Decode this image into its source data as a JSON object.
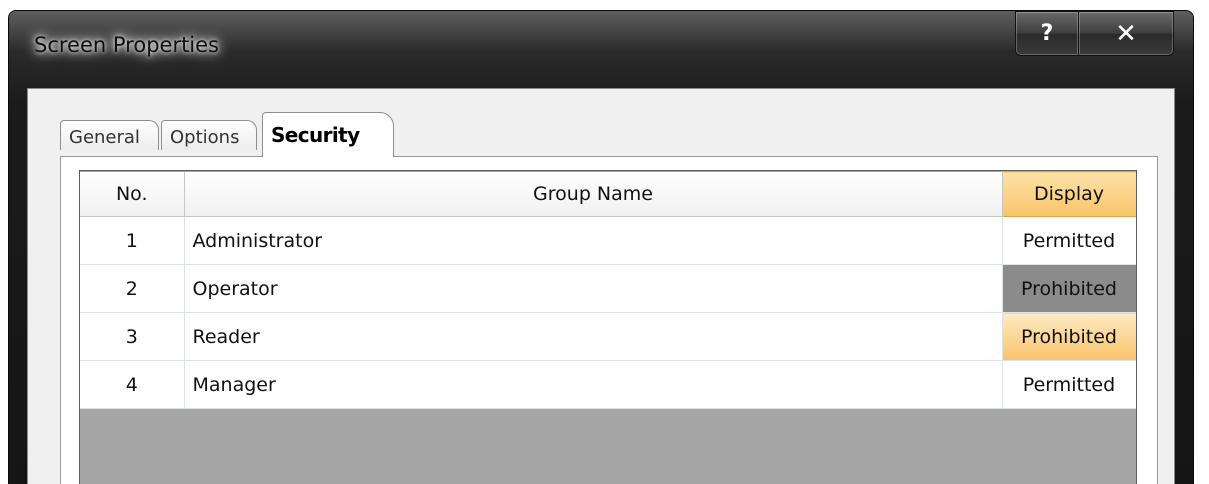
{
  "window": {
    "title": "Screen Properties",
    "help_label": "?",
    "close_label": "✕"
  },
  "tabs": [
    {
      "label": "General",
      "active": false
    },
    {
      "label": "Options",
      "active": false
    },
    {
      "label": "Security",
      "active": true
    }
  ],
  "table": {
    "headers": {
      "no": "No.",
      "group": "Group Name",
      "display": "Display"
    },
    "rows": [
      {
        "no": "1",
        "group": "Administrator",
        "display": "Permitted"
      },
      {
        "no": "2",
        "group": "Operator",
        "display": "Prohibited"
      },
      {
        "no": "3",
        "group": "Reader",
        "display": "Prohibited"
      },
      {
        "no": "4",
        "group": "Manager",
        "display": "Permitted"
      }
    ]
  },
  "colors": {
    "header_highlight": "#f9c56a",
    "cell_dark": "#8b8b8b",
    "cell_highlight": "#fac46c",
    "empty_area": "#a5a5a5"
  }
}
